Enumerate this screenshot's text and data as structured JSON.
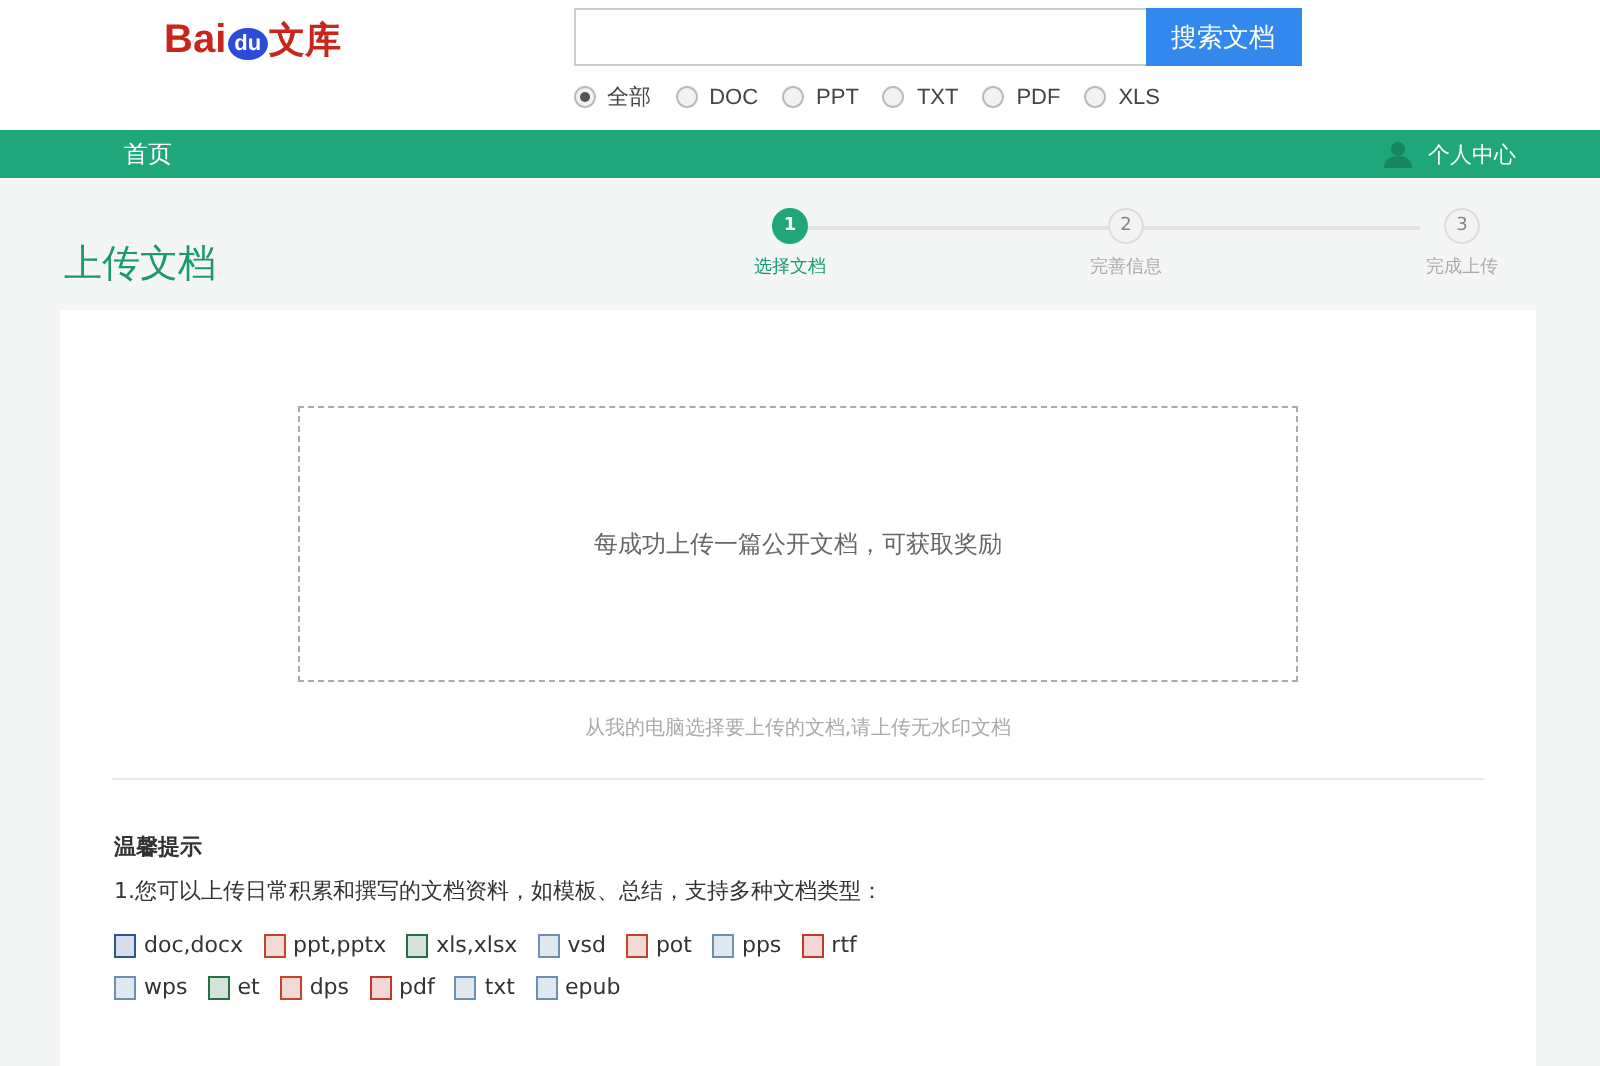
{
  "logo": {
    "part_1": "Bai",
    "part_2": "du",
    "part_3": "文库"
  },
  "search": {
    "button": "搜索文档"
  },
  "filters": [
    {
      "label": "全部",
      "selected": true
    },
    {
      "label": "DOC",
      "selected": false
    },
    {
      "label": "PPT",
      "selected": false
    },
    {
      "label": "TXT",
      "selected": false
    },
    {
      "label": "PDF",
      "selected": false
    },
    {
      "label": "XLS",
      "selected": false
    }
  ],
  "nav": {
    "home": "首页",
    "user": "个人中心"
  },
  "page_title": "上传文档",
  "steps": [
    {
      "number": "1",
      "label": "选择文档",
      "selected": true
    },
    {
      "number": "2",
      "label": "完善信息",
      "selected": false
    },
    {
      "number": "3",
      "label": "完成上传",
      "selected": false
    }
  ],
  "upload": {
    "prompt": "每成功上传一篇公开文档，可获取奖励",
    "caption": "从我的电脑选择要上传的文档,请上传无水印文档"
  },
  "tips": {
    "title": "温馨提示",
    "line_1": "1.您可以上传日常积累和撰写的文档资料，如模板、总结，支持多种文档类型：",
    "types": [
      [
        {
          "kind": "word",
          "label": "doc,docx"
        },
        {
          "kind": "ppt",
          "label": "ppt,pptx"
        },
        {
          "kind": "excel",
          "label": "xls,xlsx"
        },
        {
          "kind": "other",
          "label": "vsd"
        },
        {
          "kind": "ppt",
          "label": "pot"
        },
        {
          "kind": "other",
          "label": "pps"
        },
        {
          "kind": "pdf",
          "label": "rtf"
        }
      ],
      [
        {
          "kind": "other",
          "label": "wps"
        },
        {
          "kind": "excel",
          "label": "et"
        },
        {
          "kind": "ppt",
          "label": "dps"
        },
        {
          "kind": "pdf",
          "label": "pdf"
        },
        {
          "kind": "other",
          "label": "txt"
        },
        {
          "kind": "other",
          "label": "epub"
        }
      ]
    ]
  }
}
